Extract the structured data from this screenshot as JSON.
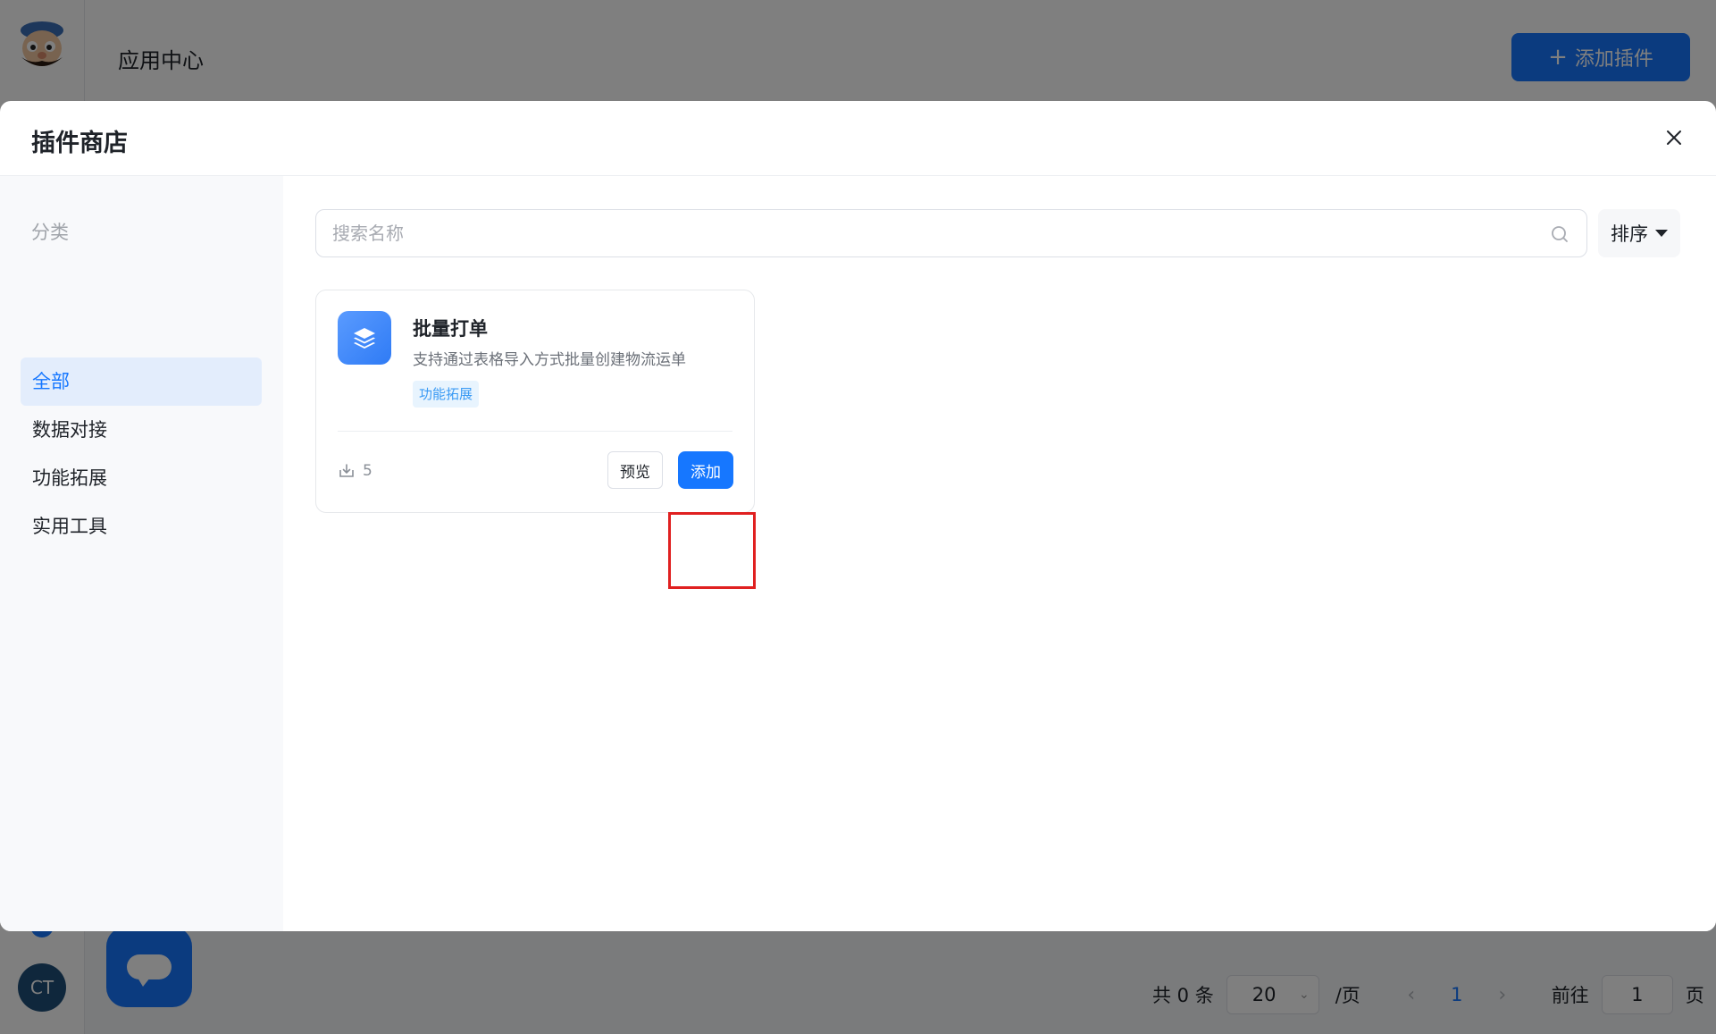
{
  "app": {
    "title": "应用中心",
    "add_plugin_label": "添加插件",
    "avatar_initials": "CT",
    "pagination": {
      "total": "共 0 条",
      "page_size": "20",
      "per_page_unit": "/页",
      "current_page": "1",
      "goto_label": "前往",
      "goto_value": "1",
      "page_unit": "页"
    }
  },
  "modal": {
    "title": "插件商店",
    "sidebar": {
      "heading": "分类",
      "items": [
        {
          "label": "全部",
          "active": true
        },
        {
          "label": "数据对接",
          "active": false
        },
        {
          "label": "功能拓展",
          "active": false
        },
        {
          "label": "实用工具",
          "active": false
        }
      ]
    },
    "search": {
      "placeholder": "搜索名称",
      "value": ""
    },
    "sort_label": "排序",
    "plugins": [
      {
        "name": "批量打单",
        "description": "支持通过表格导入方式批量创建物流运单",
        "tag": "功能拓展",
        "downloads": "5",
        "preview_label": "预览",
        "add_label": "添加",
        "icon": "layers-icon"
      }
    ]
  },
  "colors": {
    "accent": "#1677ff",
    "highlight": "#e02020",
    "tag_bg": "#e8f4fe",
    "tag_text": "#3a9af4"
  }
}
